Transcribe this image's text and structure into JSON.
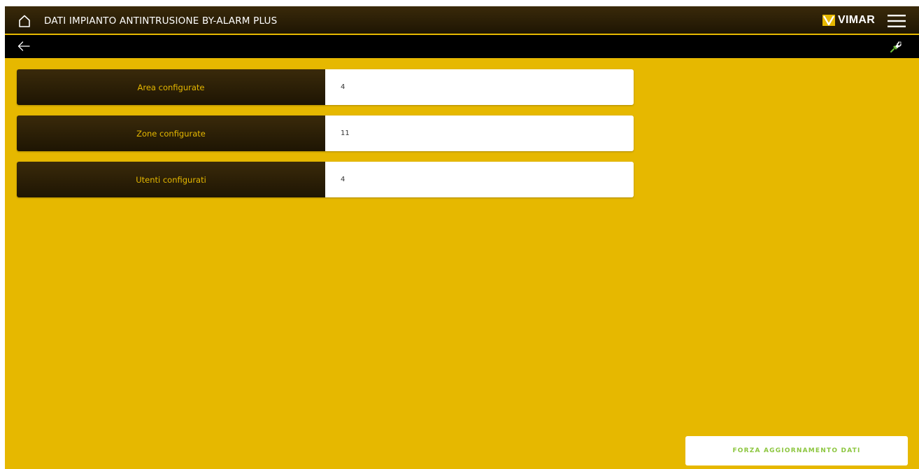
{
  "header": {
    "title": "DATI IMPIANTO ANTINTRUSIONE BY-ALARM PLUS",
    "brand": "VIMAR",
    "home_icon": "home-icon",
    "menu_icon": "hamburger-menu-icon"
  },
  "subbar": {
    "back_icon": "arrow-left-icon",
    "status_icon": "plug-connected-icon"
  },
  "rows": [
    {
      "label": "Area configurate",
      "value": "4"
    },
    {
      "label": "Zone configurate",
      "value": "11"
    },
    {
      "label": "Utenti configurati",
      "value": "4"
    }
  ],
  "actions": {
    "force_update_label": "FORZA AGGIORNAMENTO DATI"
  },
  "colors": {
    "accent": "#e6b800",
    "bar_dark": "#1e1503",
    "button_text": "#8cc63f"
  }
}
